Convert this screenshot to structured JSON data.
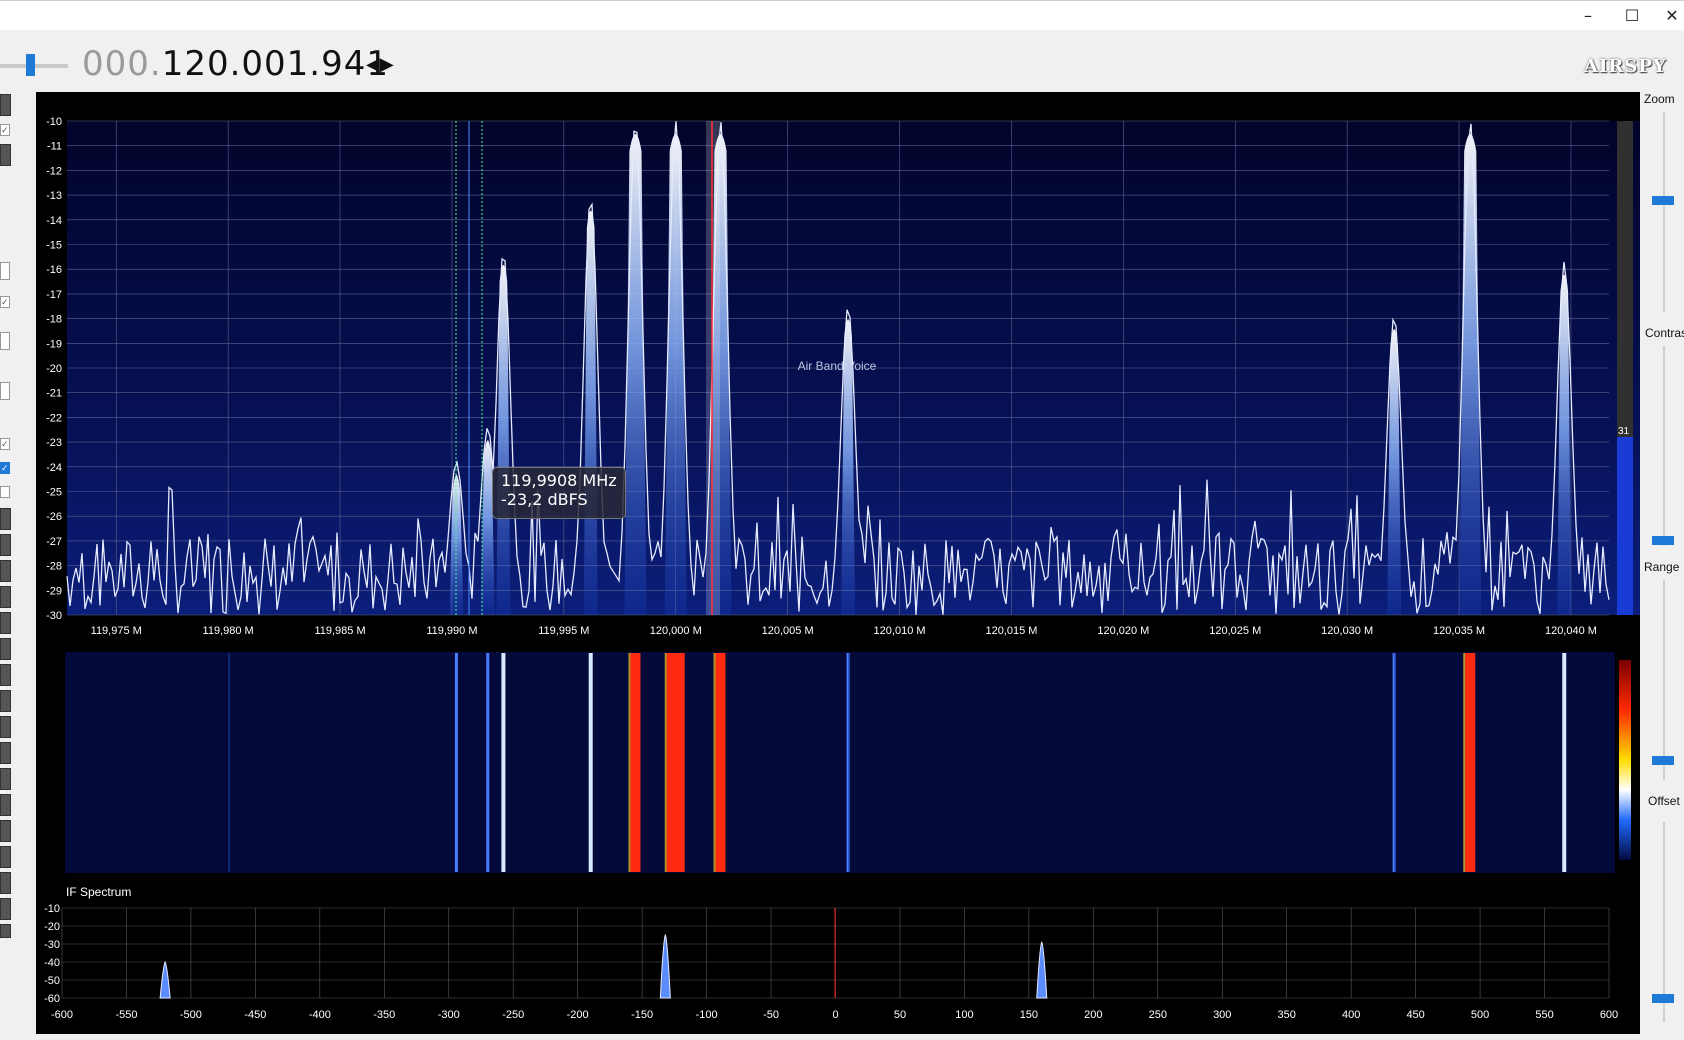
{
  "window": {
    "minimize_icon": "minimize-icon",
    "maximize_icon": "maximize-icon",
    "close_icon": "close-icon"
  },
  "frequency": {
    "dim_part": "000.",
    "value": "120.001.941",
    "step_arrows": "◀▶"
  },
  "logo": {
    "text": "AIRSPY"
  },
  "right_controls": {
    "zoom_label": "Zoom",
    "contrast_label": "Contras",
    "range_label": "Range",
    "offset_label": "Offset"
  },
  "tooltip": {
    "freq": "119,9908 MHz",
    "level": "-23,2 dBFS"
  },
  "spectrum": {
    "band_label": "Air Band Voice",
    "level_readout": "31",
    "y_ticks": [
      "-10",
      "-11",
      "-12",
      "-13",
      "-14",
      "-15",
      "-16",
      "-17",
      "-18",
      "-19",
      "-20",
      "-21",
      "-22",
      "-23",
      "-24",
      "-25",
      "-26",
      "-27",
      "-28",
      "-29",
      "-30"
    ],
    "x_ticks": [
      "119,975 M",
      "119,980 M",
      "119,985 M",
      "119,990 M",
      "119,995 M",
      "120,000 M",
      "120,005 M",
      "120,010 M",
      "120,015 M",
      "120,020 M",
      "120,025 M",
      "120,030 M",
      "120,035 M",
      "120,040 M"
    ]
  },
  "if_spectrum": {
    "title": "IF Spectrum",
    "y_ticks": [
      "-10",
      "-20",
      "-30",
      "-40",
      "-50",
      "-60"
    ],
    "x_ticks": [
      "-600",
      "-550",
      "-500",
      "-450",
      "-400",
      "-350",
      "-300",
      "-250",
      "-200",
      "-150",
      "-100",
      "-50",
      "0",
      "50",
      "100",
      "150",
      "200",
      "250",
      "300",
      "350",
      "400",
      "450",
      "500",
      "550",
      "600"
    ]
  },
  "chart_data": [
    {
      "type": "line",
      "title": "",
      "xlabel": "",
      "ylabel": "",
      "xlim": [
        119.9728,
        120.0417
      ],
      "ylim": [
        -30,
        -10
      ],
      "grid": true,
      "x_unit": "MHz",
      "y_unit": "dBFS",
      "peaks": [
        {
          "x": 119.9902,
          "y": -23.8
        },
        {
          "x": 119.9916,
          "y": -22.4
        },
        {
          "x": 119.9923,
          "y": -15.3
        },
        {
          "x": 119.9962,
          "y": -13.1
        },
        {
          "x": 119.9982,
          "y": -10
        },
        {
          "x": 120.0,
          "y": -10
        },
        {
          "x": 120.002,
          "y": -10
        },
        {
          "x": 120.0077,
          "y": -17.5
        },
        {
          "x": 120.0321,
          "y": -17.9
        },
        {
          "x": 120.0355,
          "y": -10
        },
        {
          "x": 120.0397,
          "y": -15.7
        }
      ],
      "vfo_frequency": 120.0019,
      "noise_floor": -27.5
    },
    {
      "type": "line",
      "title": "",
      "xlabel": "",
      "ylabel": "",
      "xlim": [
        -600,
        600
      ],
      "ylim": [
        -60,
        -10
      ],
      "grid": true,
      "peaks": [
        {
          "x": -520,
          "y": -40
        },
        {
          "x": -132,
          "y": -25
        },
        {
          "x": 160,
          "y": -29
        }
      ],
      "center_marker": 0
    }
  ]
}
